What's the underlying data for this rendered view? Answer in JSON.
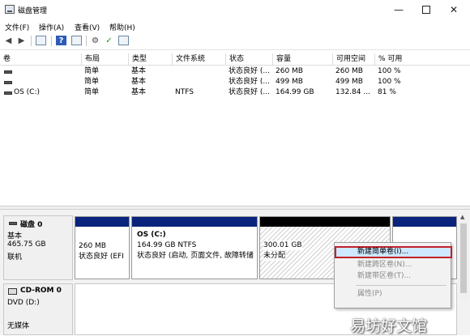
{
  "window": {
    "title": "磁盘管理"
  },
  "menu": [
    "文件(F)",
    "操作(A)",
    "查看(V)",
    "帮助(H)"
  ],
  "toolbar": {
    "icons": [
      "back-arrow-icon",
      "forward-arrow-icon",
      "console-tree-icon",
      "help-icon",
      "list-view-icon",
      "connect-icon",
      "check-icon",
      "properties-icon"
    ]
  },
  "volume_list": {
    "columns": [
      "卷",
      "布局",
      "类型",
      "文件系统",
      "状态",
      "容量",
      "可用空间",
      "% 可用"
    ],
    "rows": [
      {
        "name": "",
        "layout": "简单",
        "type": "基本",
        "fs": "",
        "status": "状态良好 (...",
        "capacity": "260 MB",
        "free": "260 MB",
        "pct": "100 %"
      },
      {
        "name": "",
        "layout": "简单",
        "type": "基本",
        "fs": "",
        "status": "状态良好 (...",
        "capacity": "499 MB",
        "free": "499 MB",
        "pct": "100 %"
      },
      {
        "name": "OS (C:)",
        "layout": "简单",
        "type": "基本",
        "fs": "NTFS",
        "status": "状态良好 (...",
        "capacity": "164.99 GB",
        "free": "132.84 ...",
        "pct": "81 %"
      }
    ]
  },
  "disks": [
    {
      "name": "磁盘 0",
      "type": "基本",
      "size": "465.75 GB",
      "state": "联机"
    },
    {
      "name": "CD-ROM 0",
      "type": "DVD (D:)",
      "state": "无媒体"
    }
  ],
  "partitions": [
    {
      "title": "",
      "size": "260 MB",
      "status": "状态良好 (EFI"
    },
    {
      "title": "OS  (C:)",
      "size": "164.99 GB NTFS",
      "status": "状态良好 (启动, 页面文件, 故障转储"
    },
    {
      "title": "",
      "size": "300.01 GB",
      "status": "未分配"
    },
    {
      "title": "",
      "size": "",
      "status": ""
    }
  ],
  "context_menu": {
    "items": [
      {
        "label": "新建简单卷(I)...",
        "enabled": true,
        "highlighted": true
      },
      {
        "label": "新建跨区卷(N)...",
        "enabled": false
      },
      {
        "label": "新建带区卷(T)...",
        "enabled": false
      },
      {
        "label": "属性(P)",
        "enabled": false
      }
    ]
  },
  "colors": {
    "partition_header_blue": "#0a237c",
    "partition_header_black": "#000000",
    "highlight_border": "#c4202a",
    "highlight_bg": "#cde8ff"
  },
  "watermark": "易坊好文馆"
}
